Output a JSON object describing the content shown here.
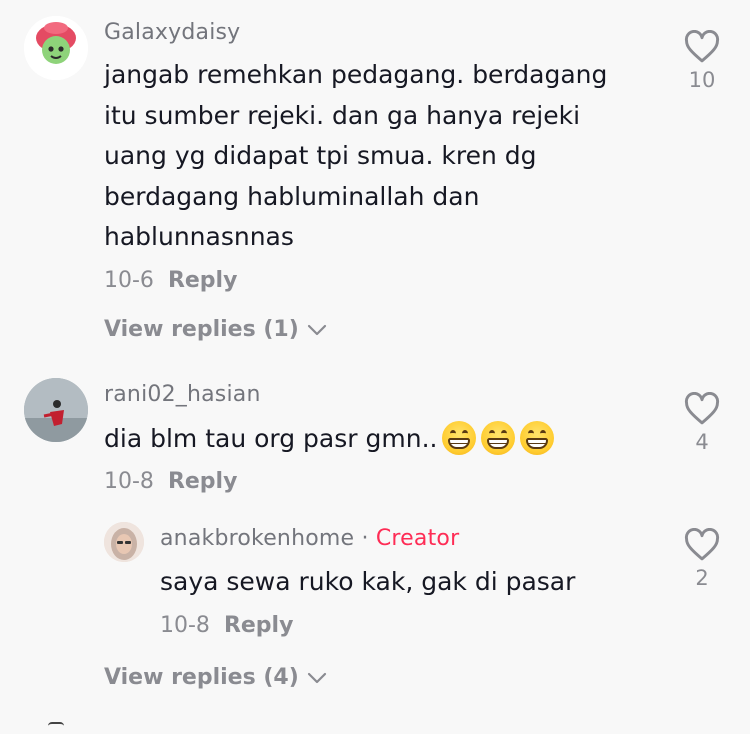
{
  "comments": [
    {
      "username": "Galaxydaisy",
      "lines": [
        "jangab remehkan pedagang. berdagang",
        "itu sumber rejeki. dan ga hanya rejeki",
        "uang yg didapat tpi smua. kren dg",
        "berdagang habluminallah dan",
        "hablunnasnnas"
      ],
      "date": "10-6",
      "reply_label": "Reply",
      "likes": "10",
      "view_replies": "View replies (1)"
    },
    {
      "username": "rani02_hasian",
      "text": "dia blm tau org pasr gmn..",
      "emoji_name": "grinning-face-emoji",
      "date": "10-8",
      "reply_label": "Reply",
      "likes": "4",
      "reply": {
        "username": "anakbrokenhome",
        "separator": "·",
        "creator_label": "Creator",
        "text": "saya sewa ruko kak, gak di pasar",
        "date": "10-8",
        "reply_label": "Reply",
        "likes": "2"
      },
      "view_replies": "View replies (4)"
    }
  ],
  "icons": {
    "like": "heart-outline-icon",
    "expand": "chevron-down-icon"
  },
  "colors": {
    "background": "#f8f8f8",
    "creator": "#fe2c55",
    "meta": "#8a8b91"
  }
}
